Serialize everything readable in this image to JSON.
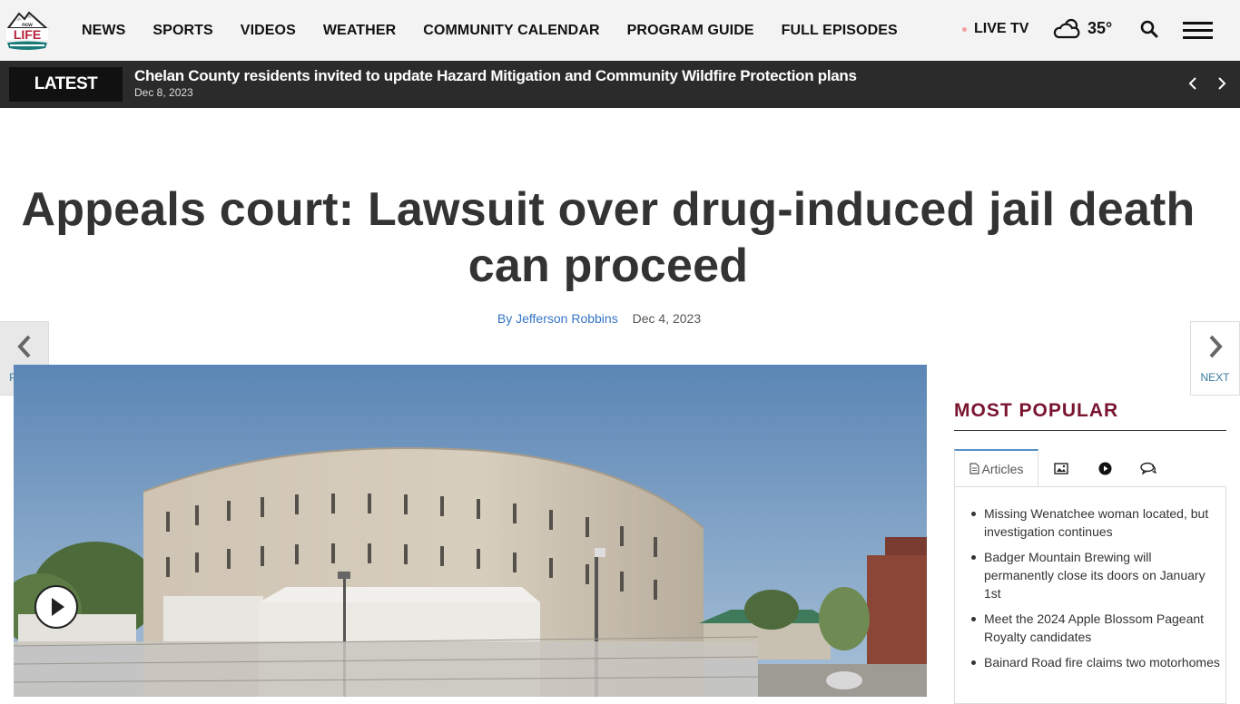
{
  "nav": {
    "logo_text": "NCW LIFE",
    "items": [
      "NEWS",
      "SPORTS",
      "VIDEOS",
      "WEATHER",
      "COMMUNITY CALENDAR",
      "PROGRAM GUIDE",
      "FULL EPISODES"
    ],
    "live_tv": "LIVE TV",
    "temperature": "35°"
  },
  "latest": {
    "label": "LATEST",
    "headline": "Chelan County residents invited to update Hazard Mitigation and Community Wildfire Protection plans",
    "date": "Dec 8, 2023"
  },
  "article": {
    "title": "Appeals court: Lawsuit over drug-induced jail death can proceed",
    "author": "By Jefferson Robbins",
    "date": "Dec 4, 2023"
  },
  "pager": {
    "prev": "PREV",
    "next": "NEXT"
  },
  "sidebar": {
    "title": "MOST POPULAR",
    "tabs": {
      "articles": "Articles"
    },
    "items": [
      "Missing Wenatchee woman located, but investigation continues",
      "Badger Mountain Brewing will permanently close its doors on January 1st",
      "Meet the 2024 Apple Blossom Pageant Royalty candidates",
      "Bainard Road fire claims two motorhomes"
    ]
  }
}
